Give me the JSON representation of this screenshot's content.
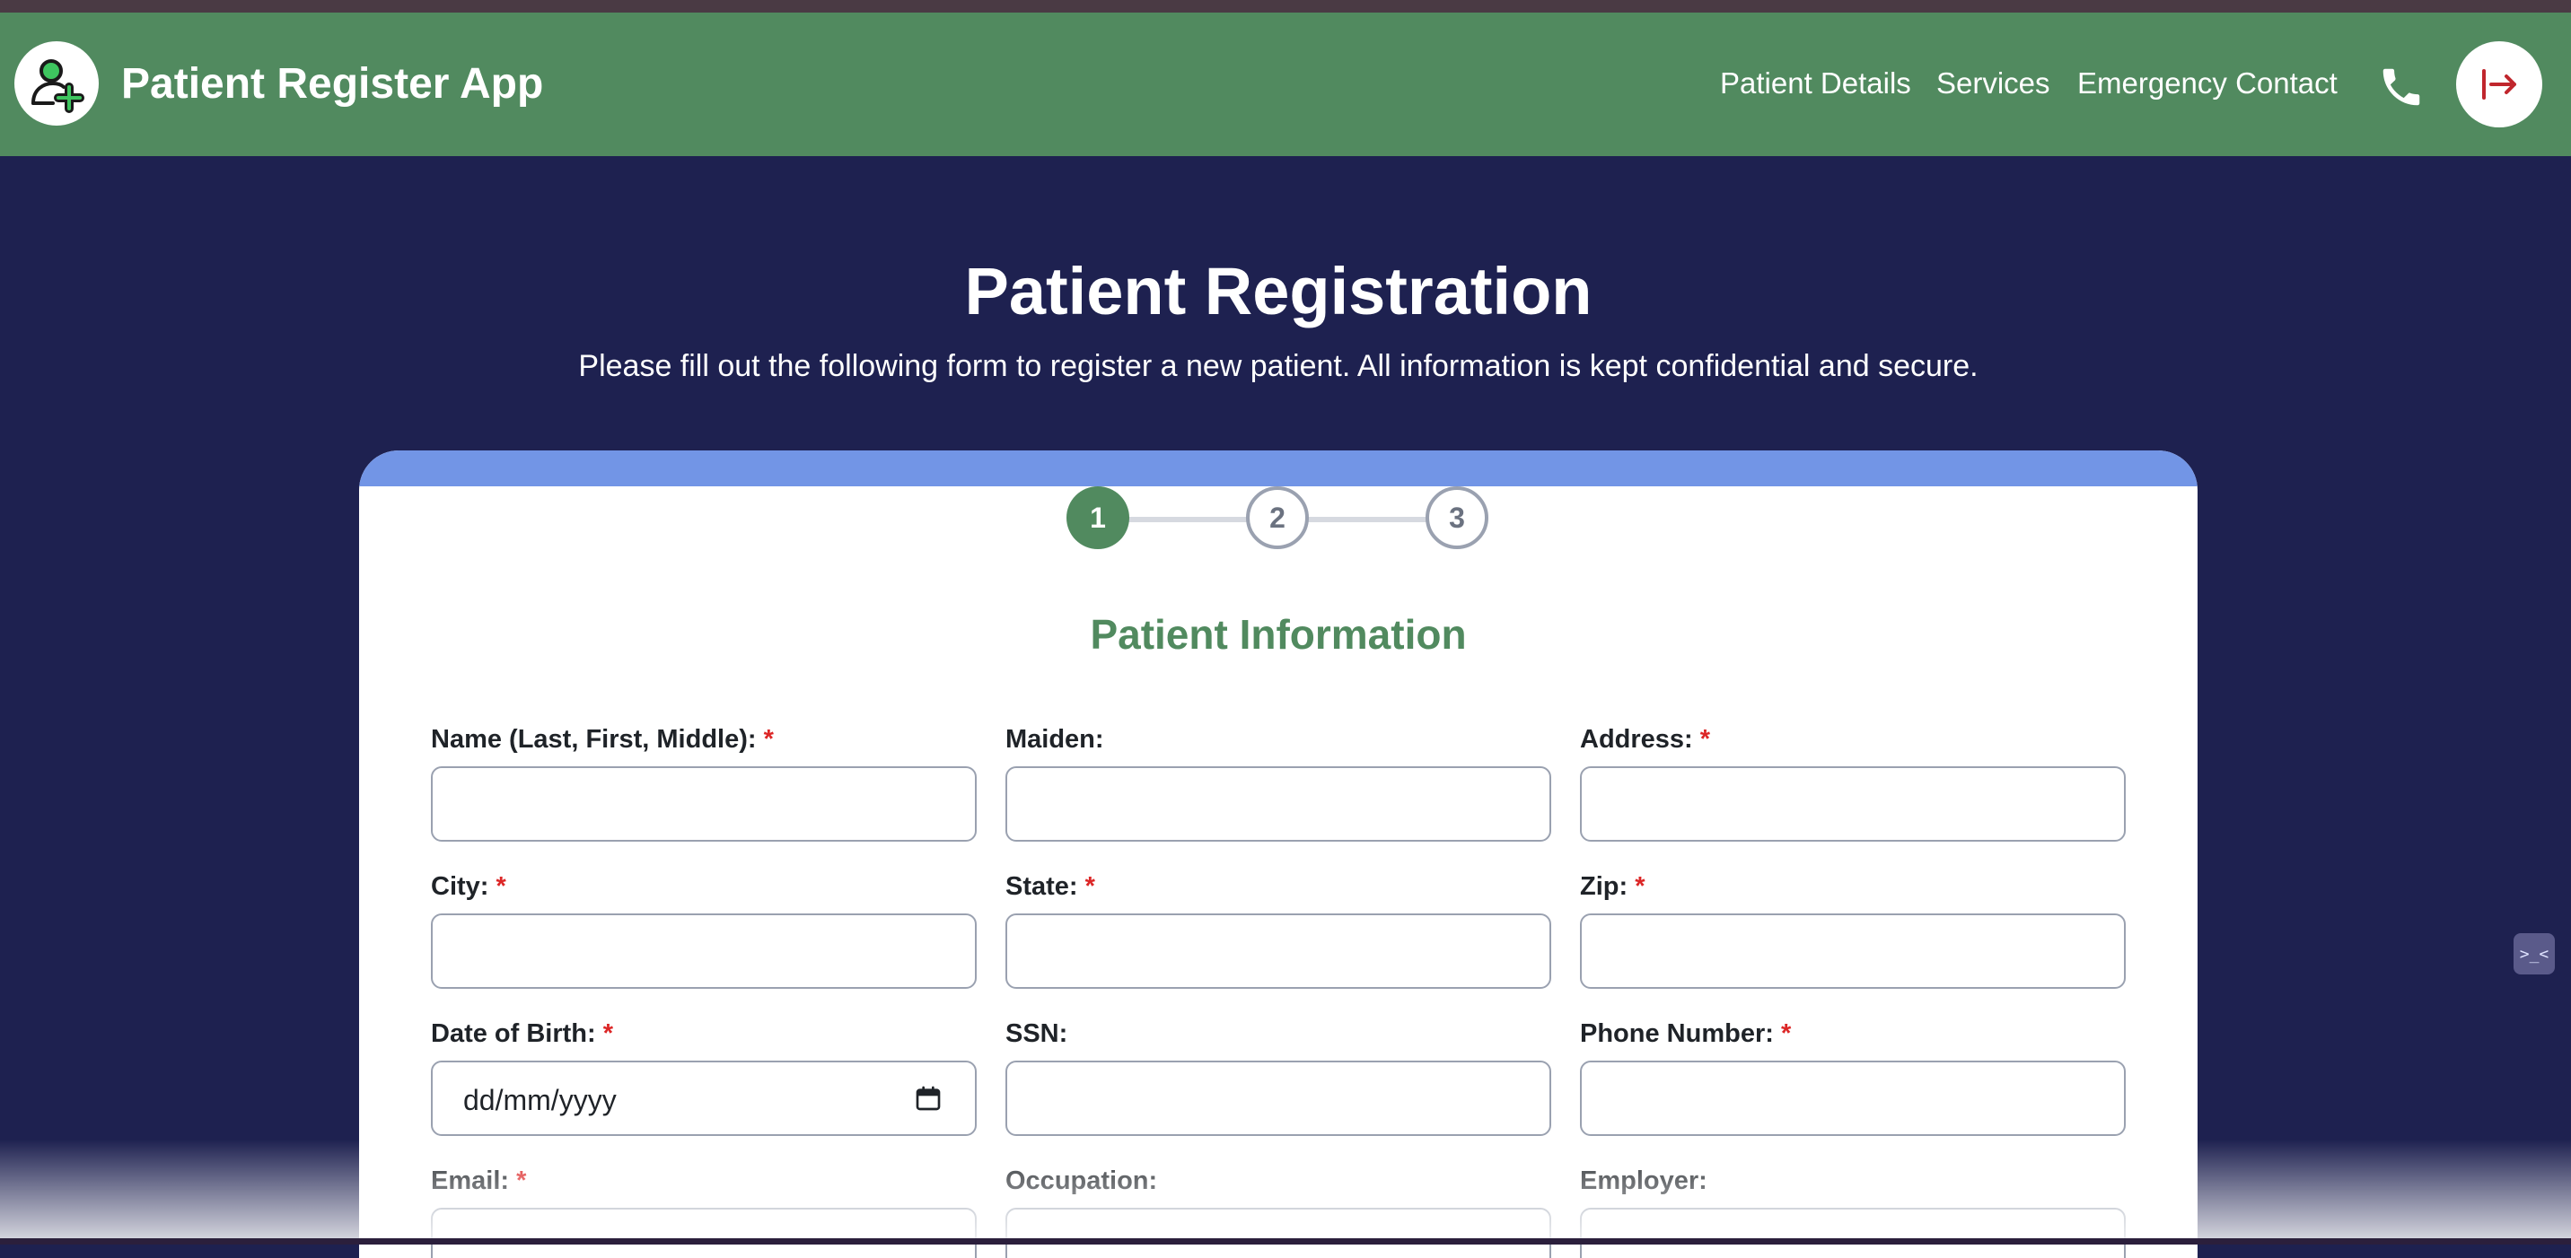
{
  "app": {
    "title": "Patient Register App",
    "logo_icon": "patient-add-icon"
  },
  "nav": {
    "links": [
      "Patient Details",
      "Services",
      "Emergency Contact"
    ],
    "phone_icon": "phone-icon",
    "logout_icon": "logout-icon",
    "logout_color": "#c0262d"
  },
  "header": {
    "title": "Patient Registration",
    "subtitle": "Please fill out the following form to register a new patient. All information is kept confidential and secure."
  },
  "stepper": {
    "steps": [
      "1",
      "2",
      "3"
    ],
    "active_step": 1
  },
  "form": {
    "section_title": "Patient Information",
    "required_mark": "*",
    "fields": [
      {
        "label": "Name (Last, First, Middle):",
        "required": true,
        "value": ""
      },
      {
        "label": "Maiden:",
        "required": false,
        "value": ""
      },
      {
        "label": "Address:",
        "required": true,
        "value": ""
      },
      {
        "label": "City:",
        "required": true,
        "value": ""
      },
      {
        "label": "State:",
        "required": true,
        "value": ""
      },
      {
        "label": "Zip:",
        "required": true,
        "value": ""
      },
      {
        "label": "Date of Birth:",
        "required": true,
        "value": "dd/mm/yyyy"
      },
      {
        "label": "SSN:",
        "required": false,
        "value": ""
      },
      {
        "label": "Phone Number:",
        "required": true,
        "value": ""
      },
      {
        "label": "Email:",
        "required": true,
        "value": ""
      },
      {
        "label": "Occupation:",
        "required": false,
        "value": ""
      },
      {
        "label": "Employer:",
        "required": false,
        "value": ""
      }
    ]
  },
  "widget": {
    "label": ">_<",
    "icon": "assistant-icon"
  },
  "colors": {
    "navbar": "#518a5f",
    "page_bg": "#1e2150",
    "accent_bar": "#7295e6",
    "required": "#dc2626"
  }
}
